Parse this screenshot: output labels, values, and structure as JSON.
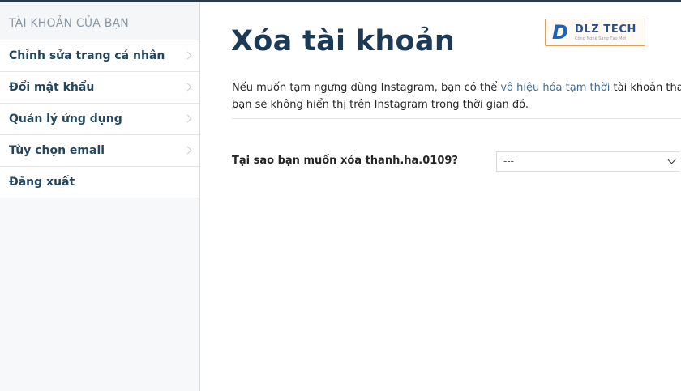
{
  "sidebar": {
    "header": "TÀI KHOẢN CỦA BẠN",
    "items": [
      {
        "label": "Chỉnh sửa trang cá nhân"
      },
      {
        "label": "Đổi mật khẩu"
      },
      {
        "label": "Quản lý ứng dụng"
      },
      {
        "label": "Tùy chọn email"
      },
      {
        "label": "Đăng xuất"
      }
    ]
  },
  "main": {
    "title": "Xóa tài khoản",
    "description": {
      "before_link": "Nếu muốn tạm ngưng dùng Instagram, bạn có thể ",
      "link": "vô hiệu hóa tạm thời",
      "after_link": " tài khoản thay vì xóa",
      "line2": "bạn sẽ không hiển thị trên Instagram trong thời gian đó."
    },
    "question": "Tại sao bạn muốn xóa thanh.ha.0109?",
    "reason_select": {
      "value": "---"
    }
  },
  "watermark": {
    "name": "DLZ TECH",
    "tagline": "Công Nghệ Sáng Tạo Mới"
  },
  "colors": {
    "accent_link": "#3d6f95",
    "title": "#1c3a56",
    "sidebar_text": "#24465e"
  }
}
